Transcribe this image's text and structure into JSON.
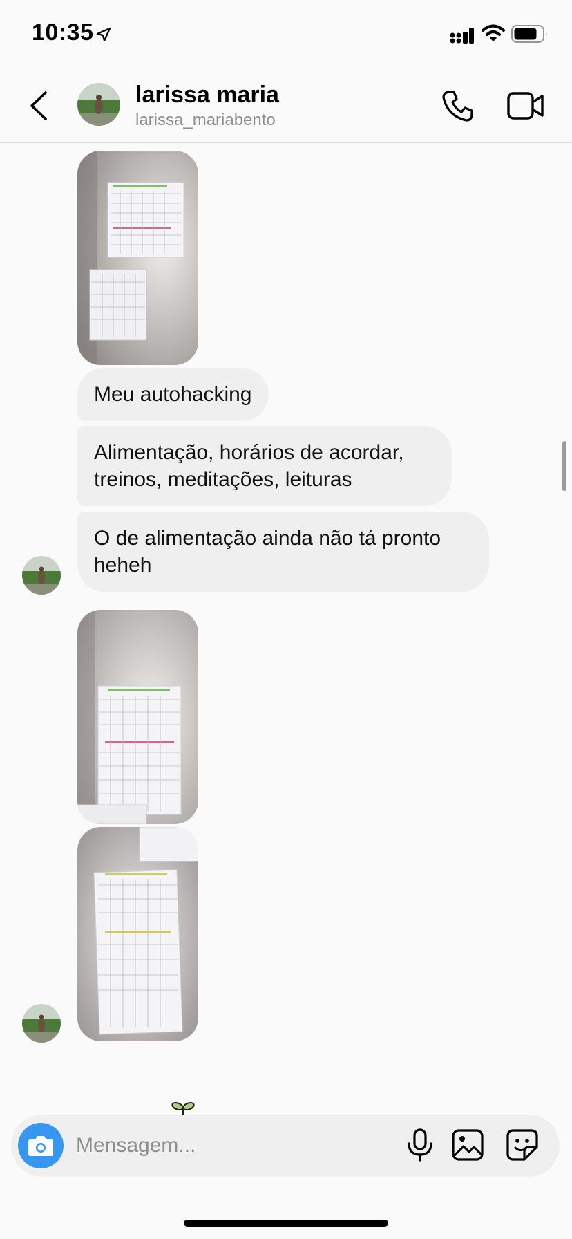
{
  "status_bar": {
    "time": "10:35",
    "icons": [
      "location-arrow-icon",
      "cellular-signal-icon",
      "wifi-icon",
      "battery-icon"
    ]
  },
  "header": {
    "contact_name": "larissa maria",
    "contact_username": "larissa_mariabento",
    "icons": [
      "chevron-left-icon",
      "phone-icon",
      "video-camera-icon"
    ]
  },
  "thread": {
    "messages": [
      {
        "type": "image",
        "alt": "photo of paper calendars on a wall"
      },
      {
        "type": "text",
        "text": "Meu autohacking"
      },
      {
        "type": "text",
        "text": "Alimentação, horários de acordar, treinos, meditações, leituras"
      },
      {
        "type": "text",
        "text": "O de alimentação ainda não tá pronto heheh"
      },
      {
        "type": "image",
        "alt": "photo of paper calendars on a wall"
      },
      {
        "type": "image",
        "alt": "photo of paper calendars on a wall"
      }
    ]
  },
  "composer": {
    "placeholder": "Mensagem...",
    "value": "",
    "icons": [
      "camera-icon",
      "microphone-icon",
      "gallery-icon",
      "sticker-icon"
    ]
  },
  "colors": {
    "accent": "#3797f0",
    "bubble": "#efefef",
    "secondary_text": "#8e8e8e",
    "background": "#fafafa"
  }
}
